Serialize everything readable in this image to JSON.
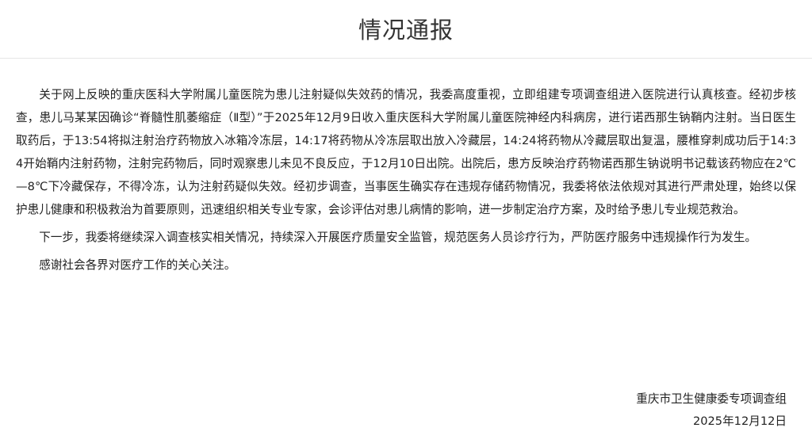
{
  "notice": {
    "title": "情况通报",
    "paragraphs": [
      "关于网上反映的重庆医科大学附属儿童医院为患儿注射疑似失效药的情况，我委高度重视，立即组建专项调查组进入医院进行认真核查。经初步核查，患儿马某某因确诊“脊髓性肌萎缩症（Ⅱ型）”于2025年12月9日收入重庆医科大学附属儿童医院神经内科病房，进行诺西那生钠鞘内注射。当日医生取药后，于13:54将拟注射治疗药物放入冰箱冷冻层，14:17将药物从冷冻层取出放入冷藏层，14:24将药物从冷藏层取出复温，腰椎穿刺成功后于14:34开始鞘内注射药物，注射完药物后，同时观察患儿未见不良反应，于12月10日出院。出院后，患方反映治疗药物诺西那生钠说明书记载该药物应在2℃—8℃下冷藏保存，不得冷冻，认为注射药疑似失效。经初步调查，当事医生确实存在违规存储药物情况，我委将依法依规对其进行严肃处理，始终以保护患儿健康和积极救治为首要原则，迅速组织相关专业专家，会诊评估对患儿病情的影响，进一步制定治疗方案，及时给予患儿专业规范救治。",
      "下一步，我委将继续深入调查核实相关情况，持续深入开展医疗质量安全监管，规范医务人员诊疗行为，严防医疗服务中违规操作行为发生。",
      "感谢社会各界对医疗工作的关心关注。"
    ],
    "signature": {
      "organization": "重庆市卫生健康委专项调查组",
      "date": "2025年12月12日"
    }
  }
}
